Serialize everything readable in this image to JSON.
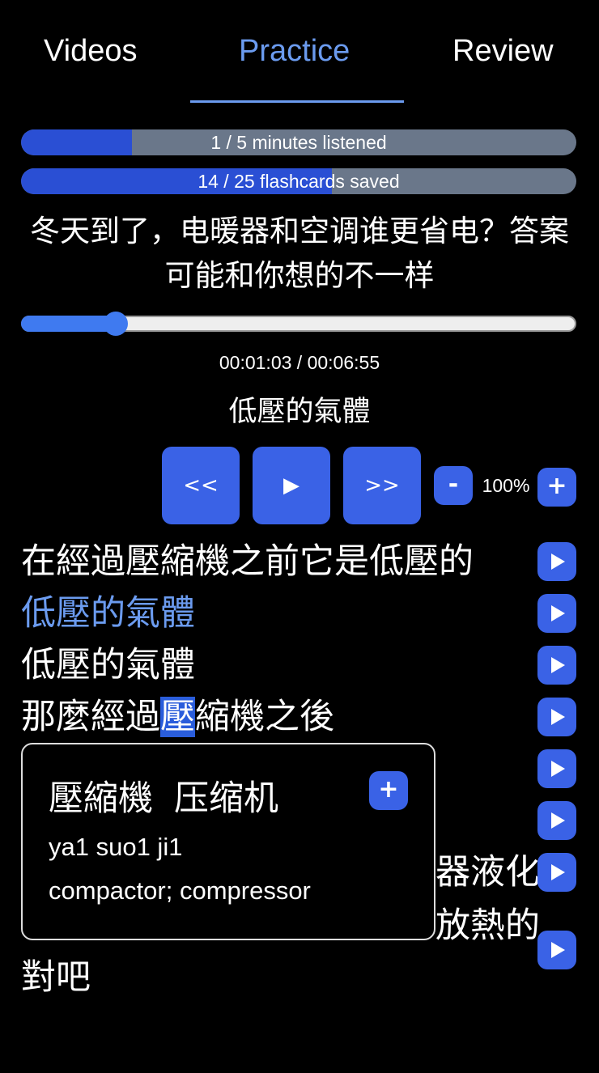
{
  "tabs": {
    "videos": "Videos",
    "practice": "Practice",
    "review": "Review",
    "active": "practice"
  },
  "progress": {
    "listened": {
      "label": "1 / 5 minutes listened",
      "fraction": 0.2
    },
    "flashcards": {
      "label": "14 / 25 flashcards saved",
      "fraction": 0.56
    }
  },
  "video": {
    "title": "冬天到了，电暖器和空调谁更省电？答案可能和你想的不一样",
    "time": "00:01:03 / 00:06:55",
    "position_fraction": 0.17,
    "current_line": "低壓的氣體"
  },
  "controls": {
    "rewind": "<<",
    "play": "▶",
    "forward": ">>",
    "speed_minus": "-",
    "speed": "100%",
    "speed_plus": "+"
  },
  "transcript": [
    {
      "text": "在經過壓縮機之前它是低壓的"
    },
    {
      "text": "低壓的氣體",
      "active": true
    },
    {
      "text": "低壓的氣體"
    },
    {
      "pre": "那麼經過",
      "highlight": "壓",
      "post": "縮機之後"
    },
    {
      "text": ""
    },
    {
      "text": ""
    },
    {
      "text": "器液化"
    },
    {
      "text": "放熱的"
    },
    {
      "text": "對吧"
    }
  ],
  "popup": {
    "traditional": "壓縮機",
    "simplified": "压缩机",
    "pinyin": "ya1 suo1 ji1",
    "definition": "compactor; compressor",
    "add": "+"
  },
  "colors": {
    "accent": "#6b9bef",
    "button": "#3a62e6",
    "bar_fill": "#2a4fd4",
    "bar_bg": "#6a778a"
  }
}
